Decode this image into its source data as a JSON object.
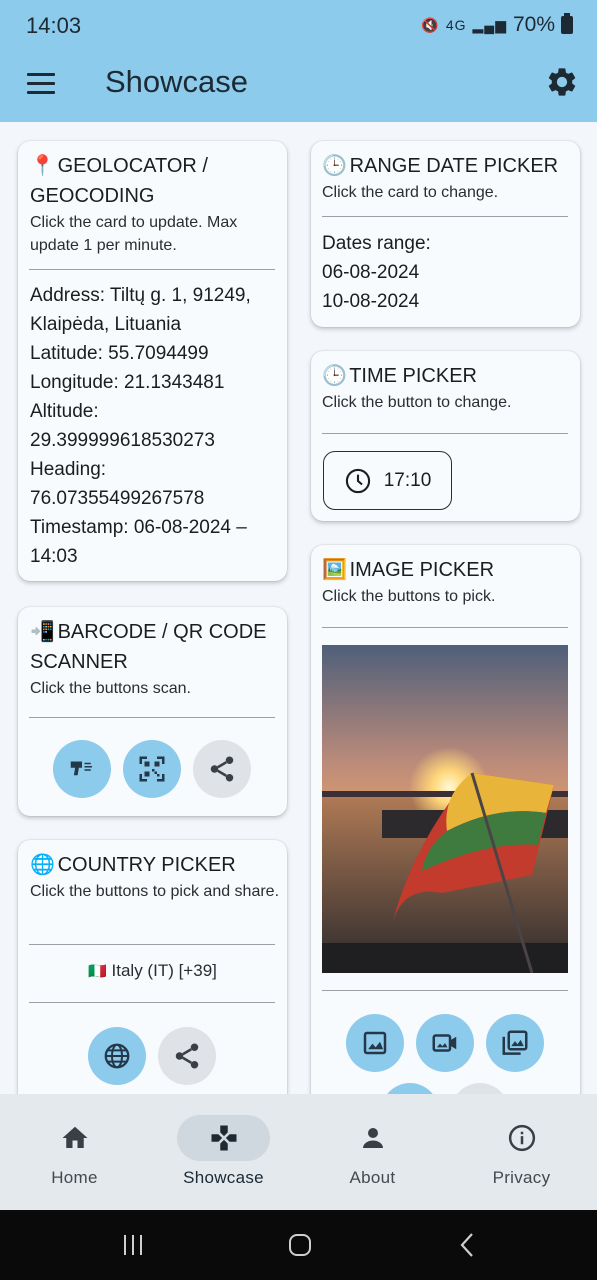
{
  "status": {
    "time": "14:03",
    "battery": "70%",
    "network": "4G"
  },
  "app_bar": {
    "title": "Showcase"
  },
  "geolocator": {
    "emoji": "📍",
    "title": "GEOLOCATOR / GEOCODING",
    "subtitle": "Click the card to update. Max update 1 per minute.",
    "address": "Address: Tiltų g. 1, 91249, Klaipėda, Lituania",
    "latitude": "Latitude: 55.7094499",
    "longitude": "Longitude: 21.1343481",
    "altitude_label": "Altitude:",
    "altitude_value": "29.399999618530273",
    "heading_label": "Heading:",
    "heading_value": "76.07355499267578",
    "timestamp": "Timestamp: 06-08-2024 – 14:03"
  },
  "barcode": {
    "emoji": "📲",
    "title": "BARCODE / QR CODE SCANNER",
    "subtitle": "Click the buttons scan.",
    "buttons": [
      "barcode-scan",
      "qr-scan",
      "share"
    ]
  },
  "country": {
    "emoji": "🌐",
    "title": "COUNTRY PICKER",
    "subtitle": "Click the buttons to pick and share.",
    "selected_flag": "🇮🇹",
    "selected": "Italy (IT) [+39]"
  },
  "range_date": {
    "emoji": "🕒",
    "title": "RANGE DATE PICKER",
    "subtitle": "Click the card to change.",
    "label": "Dates range:",
    "start": "06-08-2024",
    "end": "10-08-2024"
  },
  "time_picker": {
    "emoji": "🕒",
    "title": "TIME PICKER",
    "subtitle": "Click the button to change.",
    "value": "17:10"
  },
  "image_picker": {
    "emoji": "🖼️",
    "title": "IMAGE PICKER",
    "subtitle": "Click the buttons to pick."
  },
  "bottom_nav": {
    "items": [
      {
        "label": "Home",
        "icon": "home-icon",
        "active": false
      },
      {
        "label": "Showcase",
        "icon": "gamepad-icon",
        "active": true
      },
      {
        "label": "About",
        "icon": "person-icon",
        "active": false
      },
      {
        "label": "Privacy",
        "icon": "info-icon",
        "active": false
      }
    ]
  },
  "colors": {
    "accent": "#8ccbec",
    "nav_bg": "#e4e9ee",
    "card_bg": "#f8fbfe"
  }
}
